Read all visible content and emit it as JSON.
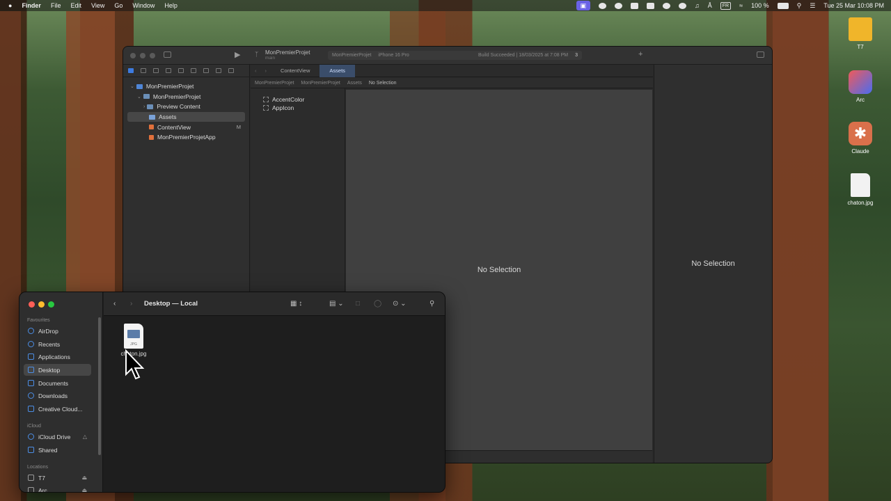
{
  "menubar": {
    "apple": "",
    "app": "Finder",
    "items": [
      "File",
      "Edit",
      "View",
      "Go",
      "Window",
      "Help"
    ],
    "battery": "100 %",
    "input_lang": "FR",
    "datetime": "Tue 25 Mar  10:08 PM"
  },
  "desktop_items": [
    {
      "label": "T7",
      "icon": "external-drive-icon"
    },
    {
      "label": "Arc",
      "icon": "arc-app-icon"
    },
    {
      "label": "Claude",
      "icon": "claude-app-icon"
    },
    {
      "label": "chaton.jpg",
      "icon": "jpg-file-icon"
    }
  ],
  "xcode": {
    "project": "MonPremierProjet",
    "branch": "main",
    "scheme": "MonPremierProjet",
    "device": "iPhone 16 Pro",
    "build_status": "Build Succeeded | 18/03/2025 at 7:08 PM",
    "warnings": "3",
    "tabs": [
      "ContentView",
      "Assets"
    ],
    "jump": [
      "MonPremierProjet",
      "MonPremierProjet",
      "Assets",
      "No Selection"
    ],
    "tree": [
      {
        "label": "MonPremierProjet",
        "badge": ""
      },
      {
        "label": "MonPremierProjet",
        "badge": ""
      },
      {
        "label": "Preview Content",
        "badge": ""
      },
      {
        "label": "Assets",
        "badge": ""
      },
      {
        "label": "ContentView",
        "badge": "M"
      },
      {
        "label": "MonPremierProjetApp",
        "badge": ""
      }
    ],
    "assets": [
      "AccentColor",
      "AppIcon"
    ],
    "editor_placeholder": "No Selection",
    "inspector_placeholder": "No Selection"
  },
  "finder": {
    "title": "Desktop — Local",
    "sections": {
      "favourites": "Favourites",
      "icloud": "iCloud",
      "locations": "Locations"
    },
    "favourites": [
      "AirDrop",
      "Recents",
      "Applications",
      "Desktop",
      "Documents",
      "Downloads",
      "Creative Cloud..."
    ],
    "icloud": [
      "iCloud Drive",
      "Shared"
    ],
    "locations": [
      "T7",
      "Arc"
    ],
    "file": {
      "name": "chaton.jpg",
      "type": "JPG"
    }
  }
}
